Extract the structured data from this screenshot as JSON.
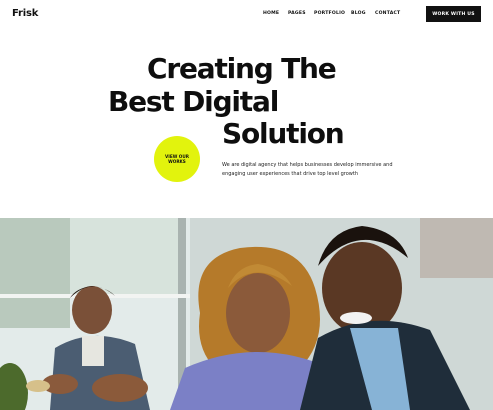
{
  "header": {
    "logo": "Frisk",
    "nav": [
      "HOME",
      "PAGES",
      "PORTFOLIO",
      "BLOG",
      "CONTACT"
    ],
    "cta": "WORK WITH US"
  },
  "hero": {
    "title_lines": [
      "Creating The",
      "Best Digital",
      "Solution"
    ],
    "works_button": "VIEW OUR WORKS",
    "description": "We are digital agency that helps businesses develop immersive and engaging user experiences that drive top level growth"
  },
  "colors": {
    "accent": "#e2f30d",
    "dark": "#111111",
    "background": "#ffffff"
  }
}
